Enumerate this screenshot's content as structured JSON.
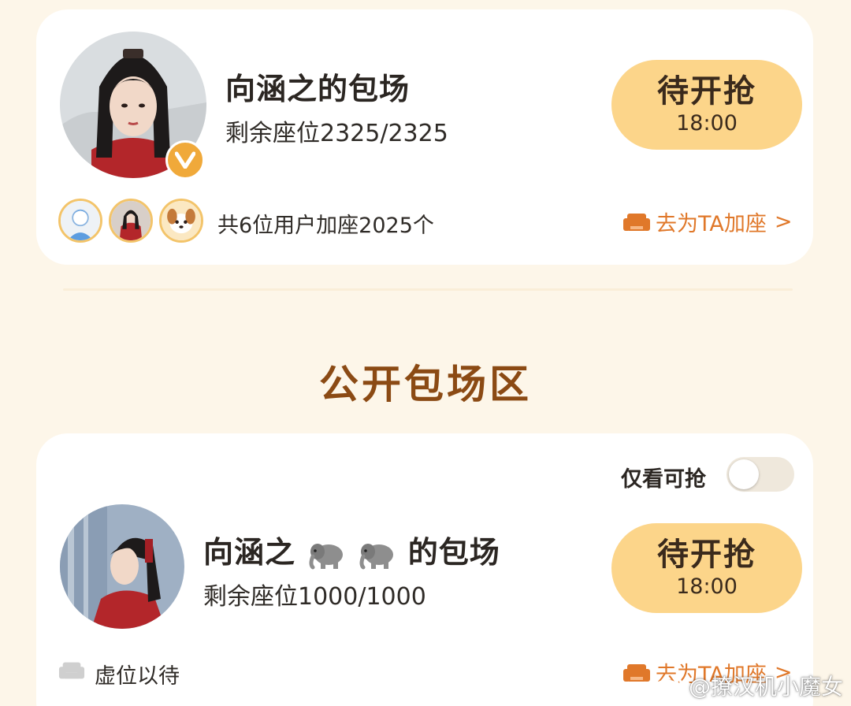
{
  "top_card": {
    "title": "向涵之的包场",
    "seats": "剩余座位2325/2325",
    "button_label": "待开抢",
    "button_time": "18:00",
    "participants_text": "共6位用户加座2025个",
    "link_label": "去为TA加座",
    "link_chevron": ">"
  },
  "section": {
    "title": "公开包场区"
  },
  "filter": {
    "label": "仅看可抢",
    "enabled": false
  },
  "bottom_card": {
    "title_start": "向涵之",
    "title_end": "的包场",
    "title_emoji": "elephant-icon",
    "seats": "剩余座位1000/1000",
    "button_label": "待开抢",
    "button_time": "18:00",
    "status_text": "虚位以待",
    "link_label": "去为TA加座",
    "link_chevron": ">"
  },
  "watermark": {
    "text": "@撩汉机小魔女"
  },
  "colors": {
    "background": "#fdf6e9",
    "button": "#fcd58a",
    "link": "#e0782a",
    "section_title": "#8b4a14",
    "verified_badge": "#f0a93a"
  }
}
